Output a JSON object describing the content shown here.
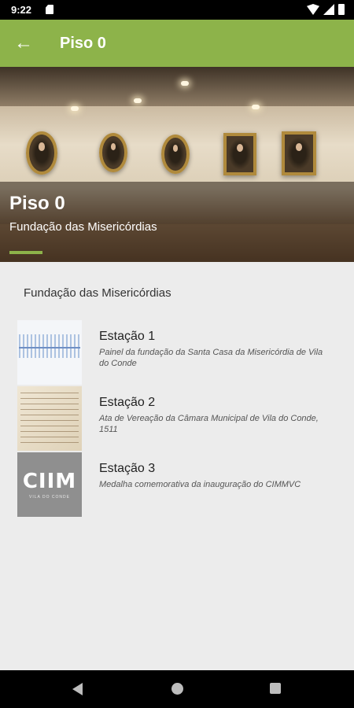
{
  "status_bar": {
    "time": "9:22"
  },
  "app_bar": {
    "title": "Piso 0",
    "back_icon": "arrow-left-icon"
  },
  "hero": {
    "title": "Piso 0",
    "subtitle": "Fundação das Misericórdias",
    "accent_color": "#8db34a"
  },
  "section": {
    "title": "Fundação das Misericórdias"
  },
  "stations": [
    {
      "title": "Estação 1",
      "description": "Painel da fundação da Santa Casa da Misericórdia de Vila do Conde"
    },
    {
      "title": "Estação 2",
      "description": "Ata de Vereação da Câmara Municipal de Vila do Conde, 1511"
    },
    {
      "title": "Estação 3",
      "description": "Medalha comemorativa da inauguração do CIMMVC"
    }
  ],
  "logo": {
    "main": "CIIM",
    "sub": "VILA DO CONDE"
  },
  "colors": {
    "primary": "#8db34a",
    "background": "#ececec"
  }
}
